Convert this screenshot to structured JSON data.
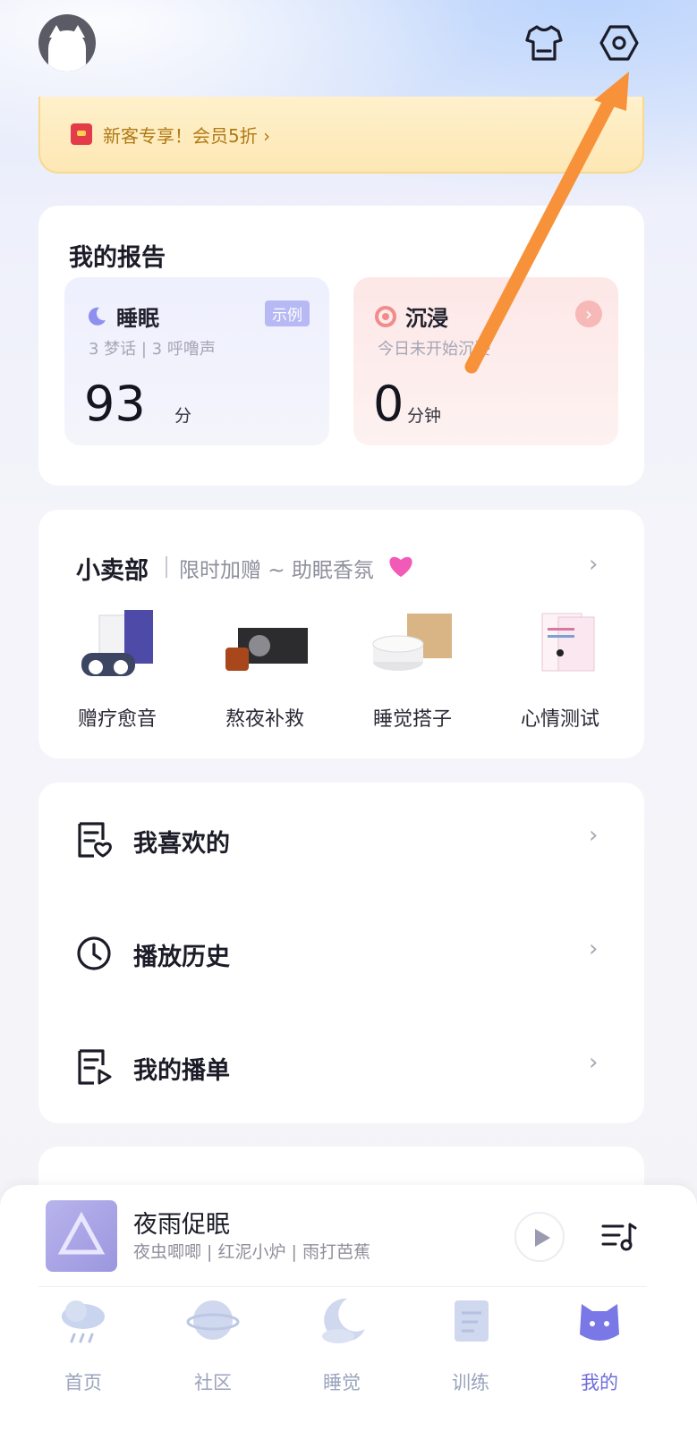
{
  "header": {
    "avatar_icon": "cat-avatar",
    "shirt_icon": "shirt-icon",
    "settings_icon": "settings-hexagon-icon"
  },
  "promo": {
    "text": "新客专享！会员5折 ›",
    "accent": "#b07a14"
  },
  "report": {
    "title": "我的报告",
    "sleep": {
      "name": "睡眠",
      "badge": "示例",
      "sub": "3 梦话 | 3 呼噜声",
      "value": "93",
      "unit": "分"
    },
    "immerse": {
      "name": "沉浸",
      "sub": "今日未开始沉浸",
      "value": "0",
      "unit": "分钟"
    }
  },
  "shop": {
    "title": "小卖部",
    "promo": "限时加赠 ~ 助眠香氛",
    "items": [
      {
        "label": "赠疗愈音"
      },
      {
        "label": "熬夜补救"
      },
      {
        "label": "睡觉搭子"
      },
      {
        "label": "心情测试"
      }
    ]
  },
  "menu": {
    "items": [
      {
        "label": "我喜欢的",
        "icon": "favorites-list-icon"
      },
      {
        "label": "播放历史",
        "icon": "clock-icon"
      },
      {
        "label": "我的播单",
        "icon": "playlist-icon"
      }
    ]
  },
  "player": {
    "title": "夜雨促眠",
    "subtitle": "夜虫唧唧 | 红泥小炉 | 雨打芭蕉"
  },
  "tabs": [
    {
      "label": "首页",
      "icon": "rain-cloud-icon"
    },
    {
      "label": "社区",
      "icon": "planet-icon"
    },
    {
      "label": "睡觉",
      "icon": "moon-cloud-icon"
    },
    {
      "label": "训练",
      "icon": "notebook-icon"
    },
    {
      "label": "我的",
      "icon": "cat-icon",
      "active": true
    }
  ],
  "colors": {
    "annotation_arrow": "#f7923a",
    "active_tab": "#6f6ddc"
  }
}
